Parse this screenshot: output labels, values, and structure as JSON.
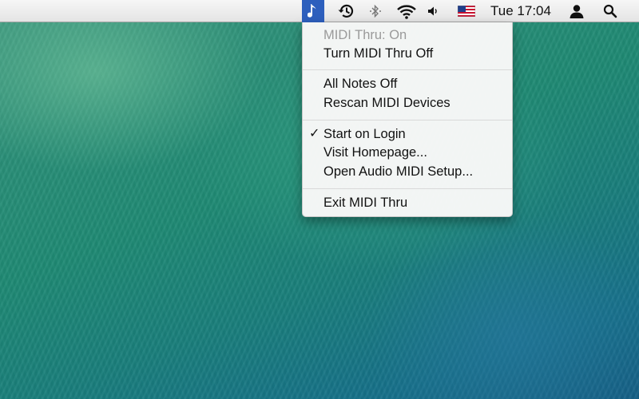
{
  "menubar": {
    "clock": "Tue 17:04",
    "icons": {
      "midi": "music-note-icon",
      "time_machine": "time-machine-icon",
      "bluetooth": "bluetooth-icon",
      "wifi": "wifi-icon",
      "volume": "volume-icon",
      "input_source": "us-flag-icon",
      "user": "user-icon",
      "search": "spotlight-search-icon"
    },
    "active_item_color": "#2d5fbd"
  },
  "midi_menu": {
    "status": "MIDI Thru: On",
    "toggle": "Turn MIDI Thru Off",
    "all_notes_off": "All Notes Off",
    "rescan": "Rescan MIDI Devices",
    "start_on_login": "Start on Login",
    "start_on_login_checked": true,
    "check_mark": "✓",
    "homepage": "Visit Homepage...",
    "audio_midi_setup": "Open Audio MIDI Setup...",
    "exit": "Exit MIDI Thru"
  }
}
